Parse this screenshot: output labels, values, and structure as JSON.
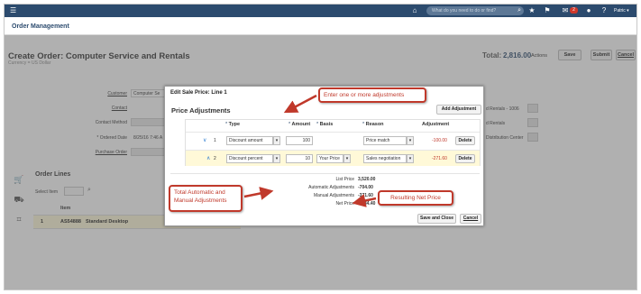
{
  "topbar": {
    "search_placeholder": "What do you need to do or find?",
    "notification_count": "2",
    "user_name": "Patric ▾"
  },
  "app_title": "Order Management",
  "page": {
    "title": "Create Order: Computer Service and Rentals",
    "currency": "Currency = US Dollar",
    "total_label": "Total:",
    "total_value": "2,816.00",
    "actions_label": "Actions",
    "save_label": "Save",
    "submit_label": "Submit",
    "cancel_label": "Cancel"
  },
  "form": {
    "customer_label": "Customer",
    "customer_value": "Computer Se",
    "contact_label": "Contact",
    "contact_method_label": "Contact Method",
    "ordered_date_label": "* Ordered Date",
    "ordered_date_value": "8/25/16 7:46 A",
    "purchase_order_label": "Purchase Order",
    "right_field_1": "d Rentals - 1006",
    "right_field_2": "d Rentals",
    "right_field_3": "Distribution Center"
  },
  "order_lines": {
    "title": "Order Lines",
    "select_item_label": "Select Item",
    "item_header": "Item",
    "row": {
      "num": "1",
      "item": "AS54888",
      "desc": "Standard Desktop"
    }
  },
  "modal": {
    "title": "Edit Sale Price: Line 1",
    "section_title": "Price Adjustments",
    "add_button": "Add Adjustment",
    "columns": {
      "type": "Type",
      "amount": "Amount",
      "basis": "Basis",
      "reason": "Reason",
      "adjustment": "Adjustment",
      "required_marker": "*"
    },
    "rows": [
      {
        "num": "1",
        "type": "Discount amount",
        "amount": "100",
        "basis": "",
        "reason": "Price match",
        "adjustment": "-100.00",
        "delete": "Delete"
      },
      {
        "num": "2",
        "type": "Discount percent",
        "amount": "10",
        "basis": "Your Price",
        "reason": "Sales negotiation",
        "adjustment": "-271.60",
        "delete": "Delete"
      }
    ],
    "summary": {
      "list_price_label": "List Price",
      "list_price": "3,520.00",
      "auto_adj_label": "Automatic Adjustments",
      "auto_adj": "-704.00",
      "manual_adj_label": "Manual Adjustments",
      "manual_adj": "-371.60",
      "net_price_label": "Net Price",
      "net_price": "2,444.40"
    },
    "save_close": "Save and Close",
    "cancel": "Cancel"
  },
  "callouts": {
    "enter_adjustments": "Enter one or more adjustments",
    "total_adjustments": "Total Automatic and Manual Adjustments",
    "net_price": "Resulting Net Price"
  },
  "colors": {
    "topbar": "#2c4b6e",
    "callout_red": "#c0392b",
    "negative": "#c0392b"
  },
  "icons": [
    "hamburger-icon",
    "home-icon",
    "search-icon",
    "star-icon",
    "flag-icon",
    "notifications-icon",
    "info-icon",
    "help-icon",
    "cart-icon",
    "truck-icon",
    "tag-icon",
    "chevron-down-icon"
  ]
}
